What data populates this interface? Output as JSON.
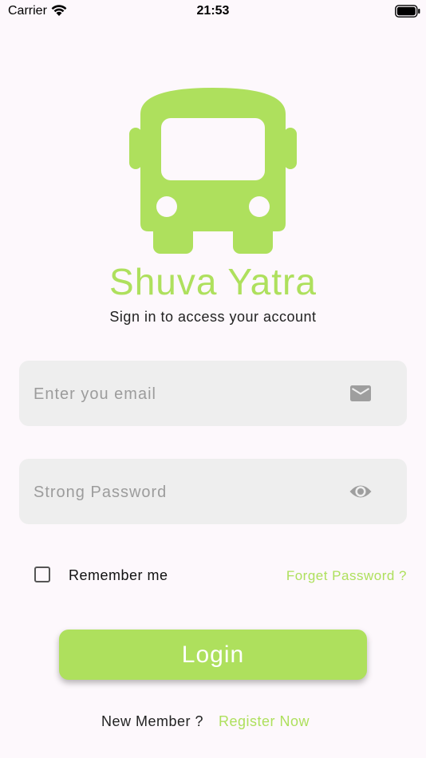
{
  "status_bar": {
    "carrier": "Carrier",
    "time": "21:53",
    "wifi_icon": "wifi-icon",
    "battery_icon": "battery-icon"
  },
  "app": {
    "logo_icon": "bus-icon",
    "title": "Shuva Yatra",
    "subtitle": "Sign in to access your account"
  },
  "form": {
    "email": {
      "placeholder": "Enter you email",
      "value": "",
      "icon": "mail-icon"
    },
    "password": {
      "placeholder": "Strong Password",
      "value": "",
      "icon": "eye-icon"
    },
    "remember_label": "Remember me",
    "remember_checked": false,
    "forget_label": "Forget Password ?",
    "login_label": "Login"
  },
  "footer": {
    "prompt": "New Member ?",
    "register_label": "Register Now"
  },
  "colors": {
    "accent": "#aee05d",
    "background": "#fdf8fc",
    "field_bg": "#eeeeee",
    "icon_gray": "#9e9e9e"
  }
}
